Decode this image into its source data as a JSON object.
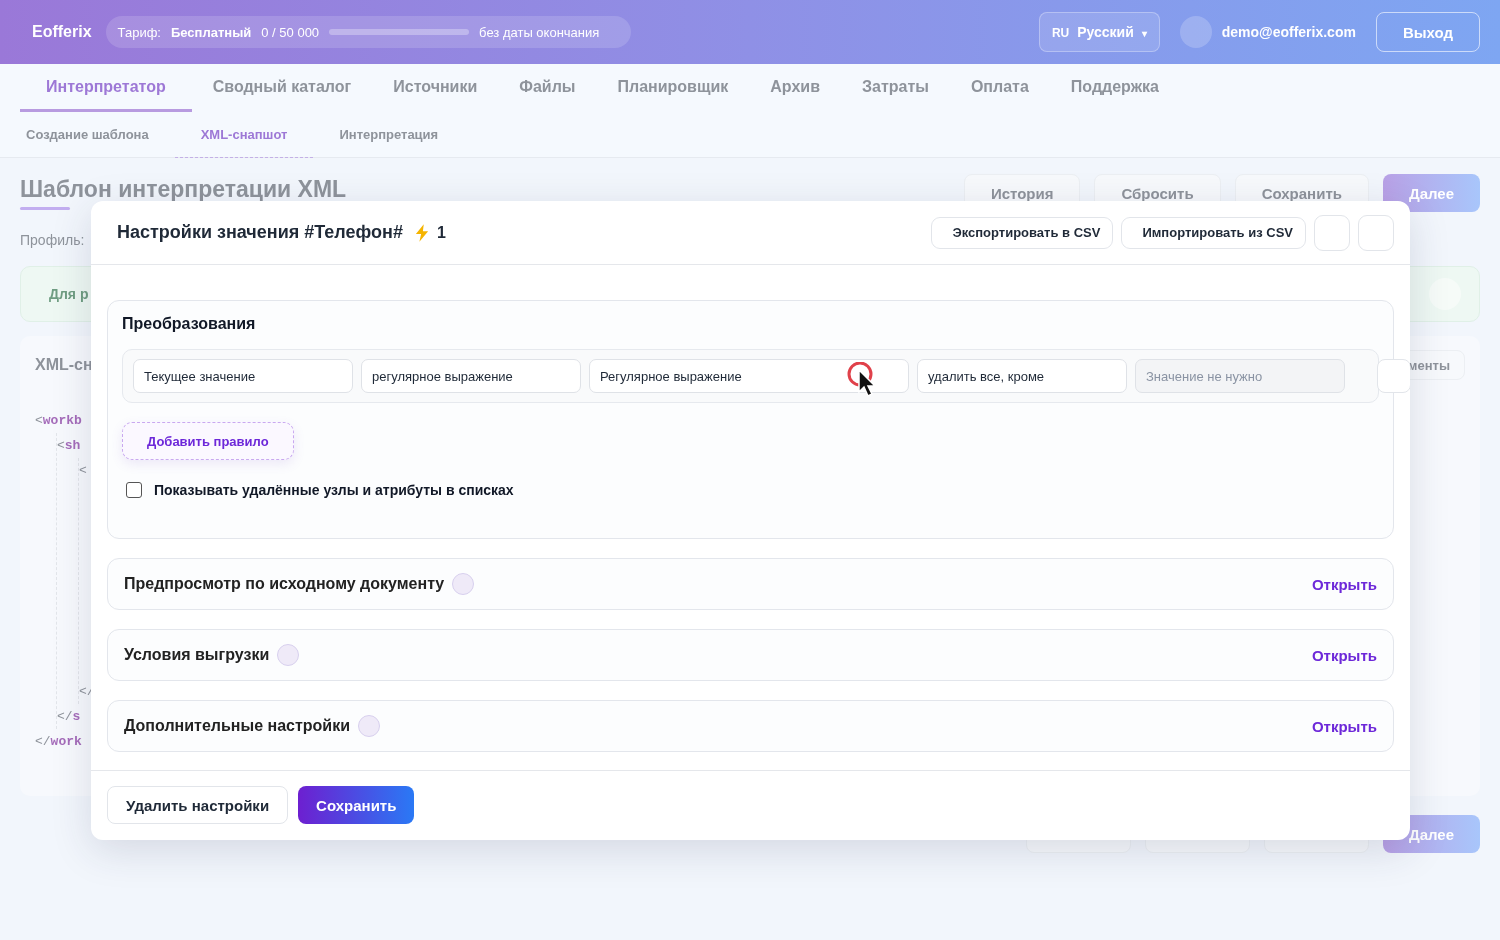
{
  "header": {
    "logo": "Eofferix",
    "plan": {
      "label": "Тариф:",
      "name": "Бесплатный",
      "usage": "0 / 50 000",
      "level": 0,
      "expiry": "без даты окончания"
    },
    "language": {
      "code": "RU",
      "name": "Русский",
      "caret": "▾"
    },
    "user": {
      "email": "demo@eofferix.com"
    },
    "logout": "Выход"
  },
  "tabs": [
    {
      "label": "Интерпретатор",
      "selected": true
    },
    {
      "label": "Сводный каталог",
      "selected": false
    },
    {
      "label": "Источники",
      "selected": false
    },
    {
      "label": "Файлы",
      "selected": false
    },
    {
      "label": "Планировщик",
      "selected": false
    },
    {
      "label": "Архив",
      "selected": false
    },
    {
      "label": "Затраты",
      "selected": false
    },
    {
      "label": "Оплата",
      "selected": false
    },
    {
      "label": "Поддержка",
      "selected": false
    }
  ],
  "subtabs": [
    {
      "label": "Создание шаблона",
      "selected": false
    },
    {
      "label": "XML-снапшот",
      "selected": true
    },
    {
      "label": "Интерпретация",
      "selected": false
    }
  ],
  "page": {
    "title": "Шаблон интерпретации XML",
    "actions": [
      {
        "kind": "secondary",
        "label": "История"
      },
      {
        "kind": "secondary",
        "label": "Сбросить"
      },
      {
        "kind": "secondary",
        "label": "Сохранить"
      },
      {
        "kind": "primary",
        "label": "Далее"
      }
    ],
    "profile_label": "Профиль:",
    "notice": "Для р",
    "panel": {
      "title": "XML-сн",
      "side_button": "менты",
      "code": [
        {
          "open_mark": "<",
          "open_tag": "workb",
          "close_mark": "</",
          "close_tag": "work",
          "children": [
            {
              "open_mark": "<",
              "open_tag": "sh",
              "close_mark": "</",
              "close_tag": "s",
              "children": [
                {
                  "open_mark": "<",
                  "close_mark": "</"
                }
              ]
            }
          ]
        }
      ]
    },
    "bottom_actions": [
      {
        "kind": "covered"
      },
      {
        "kind": "covered"
      },
      {
        "kind": "covered"
      },
      {
        "kind": "primary",
        "label": "Далее"
      }
    ]
  },
  "modal": {
    "title": "Настройки значения #Телефон#",
    "count": "1",
    "actions": [
      "Экспортировать в CSV",
      "Импортировать из CSV"
    ],
    "transformations": {
      "title": "Преобразования",
      "rule": [
        {
          "value": "Текущее значение",
          "disabled": false
        },
        {
          "value": "регулярное выражение",
          "disabled": false
        },
        {
          "value": "Регулярное выражение",
          "disabled": false
        },
        {
          "value": "удалить все, кроме",
          "disabled": false
        },
        {
          "placeholder": "Значение не нужно",
          "disabled": true
        }
      ],
      "add_rule": "Добавить правило",
      "show_deleted": {
        "label": "Показывать удалённые узлы и атрибуты в списках",
        "checked": false
      }
    },
    "sections": [
      {
        "title": "Предпросмотр по исходному документу",
        "action": "Открыть"
      },
      {
        "title": "Условия выгрузки",
        "action": "Открыть"
      },
      {
        "title": "Дополнительные настройки",
        "action": "Открыть"
      }
    ],
    "footer": [
      {
        "kind": "secondary",
        "label": "Удалить настройки"
      },
      {
        "kind": "primary",
        "label": "Сохранить"
      }
    ]
  }
}
